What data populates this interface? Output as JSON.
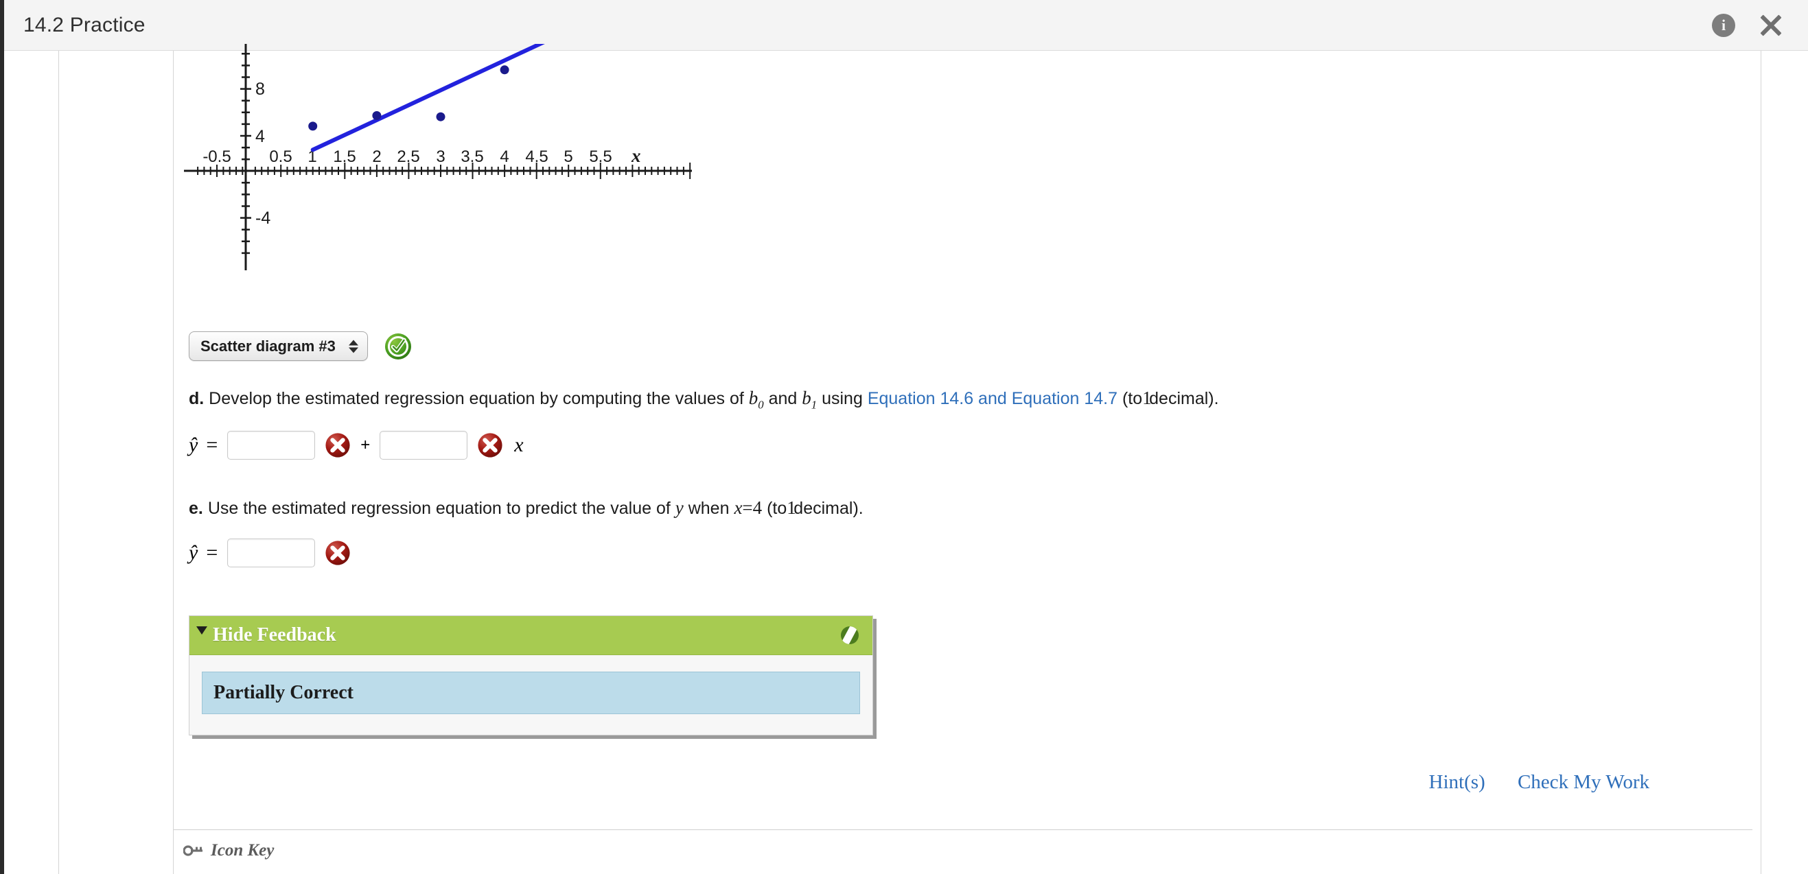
{
  "window": {
    "title": "14.2 Practice",
    "info_icon": "info-icon",
    "close_icon": "close-icon"
  },
  "scatter": {
    "selected_option": "Scatter diagram #3",
    "options": [
      "Scatter diagram #3"
    ],
    "status_icon": "correct-check-icon"
  },
  "chart_data": {
    "type": "scatter",
    "title": "",
    "xlabel": "x",
    "ylabel": "",
    "x": [
      1,
      2,
      3,
      4
    ],
    "y": [
      3.8,
      4.7,
      4.6,
      8.6
    ],
    "series": [
      {
        "name": "data points",
        "x": [
          1,
          2,
          3,
          4
        ],
        "y": [
          3.8,
          4.7,
          4.6,
          8.6
        ],
        "color": "#1a1a8c"
      },
      {
        "name": "regression line",
        "x": [
          1.0,
          4.75
        ],
        "y": [
          2.2,
          11.3
        ],
        "color": "#2222dd"
      }
    ],
    "xlim": [
      -0.8,
      5.9
    ],
    "ylim": [
      -6.5,
      11.5
    ],
    "xticks": [
      -0.5,
      0.5,
      1,
      1.5,
      2,
      2.5,
      3,
      3.5,
      4,
      4.5,
      5,
      5.5
    ],
    "xticklabels": [
      "-0.5",
      "0.5",
      "1",
      "1.5",
      "2",
      "2.5",
      "3",
      "3.5",
      "4",
      "4.5",
      "5",
      "5.5"
    ],
    "yticks": [
      8,
      4,
      -4
    ],
    "yticklabels": [
      "8",
      "4",
      "-4"
    ],
    "minor_tick_step_x": 0.1,
    "minor_tick_step_y": 1,
    "grid": false,
    "legend": "none"
  },
  "question_d": {
    "letter": "d.",
    "text_1": "Develop the estimated regression equation by computing the values of",
    "b0": "b",
    "b0_sub": "0",
    "and": "and",
    "b1": "b",
    "b1_sub": "1",
    "using": "using",
    "link": "Equation 14.6 and Equation 14.7",
    "text_2": "(to",
    "decimals": "1",
    "text_3": "decimal).",
    "yhat": "ŷ",
    "equals": "=",
    "plus": "+",
    "xvar": "x",
    "input_b0_value": "",
    "input_b0_placeholder": "",
    "input_b1_value": "",
    "input_b1_placeholder": "",
    "mark_b0": "incorrect-x-icon",
    "mark_b1": "incorrect-x-icon"
  },
  "question_e": {
    "letter": "e.",
    "text_1": "Use the estimated regression equation to predict the value of",
    "yvar": "y",
    "when": "when",
    "xvar": "x",
    "equals_sign": "=",
    "xvalue": "4",
    "text_2": "(to",
    "decimals": "1",
    "text_3": "decimal).",
    "yhat": "ŷ",
    "equals": "=",
    "input_value": "",
    "input_placeholder": "",
    "mark": "incorrect-x-icon"
  },
  "feedback": {
    "header_label": "Hide Feedback",
    "header_color": "#a7cb51",
    "status_text": "Partially Correct",
    "status_color": "#bcdcea",
    "toggle_icon": "collapse-triangle-icon",
    "header_action_icon": "feedback-options-icon"
  },
  "bottom": {
    "hints_label": "Hint(s)",
    "check_label": "Check My Work",
    "link_color": "#2f6fba"
  },
  "icon_key": {
    "label": "Icon Key",
    "icon": "key-icon"
  },
  "scrollbar": {
    "thumb_color": "#eeabcd"
  }
}
